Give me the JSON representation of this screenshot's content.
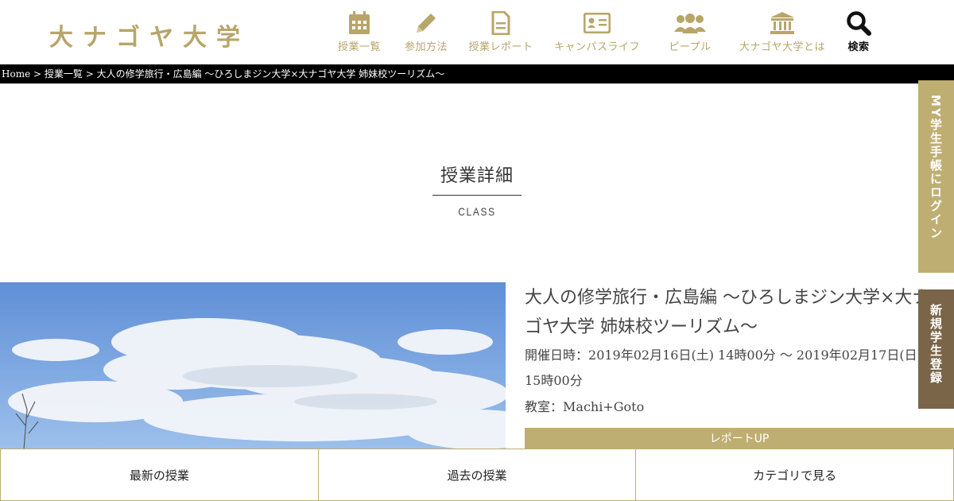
{
  "brand": {
    "logo_text": "大ナゴヤ大学",
    "accent_color": "#bfae72",
    "dark_accent": "#7a6548"
  },
  "nav": {
    "items": [
      {
        "label": "授業一覧",
        "icon": "calendar-icon"
      },
      {
        "label": "参加方法",
        "icon": "pencil-icon"
      },
      {
        "label": "授業レポート",
        "icon": "document-icon"
      },
      {
        "label": "キャンパスライフ",
        "icon": "id-card-icon"
      },
      {
        "label": "ピープル",
        "icon": "people-icon"
      },
      {
        "label": "大ナゴヤ大学とは",
        "icon": "university-icon"
      },
      {
        "label": "検索",
        "icon": "search-icon"
      }
    ]
  },
  "breadcrumb": {
    "home": "Home",
    "sep": " > ",
    "list": "授業一覧",
    "current": "大人の修学旅行・広島編 〜ひろしまジン大学×大ナゴヤ大学 姉妹校ツーリズム〜"
  },
  "section": {
    "title": "授業詳細",
    "subtitle": "CLASS"
  },
  "class": {
    "title": "大人の修学旅行・広島編 〜ひろしまジン大学×大ナゴヤ大学 姉妹校ツーリズム〜",
    "date_label": "開催日時：",
    "date_value": "2019年02月16日(土) 14時00分 ～ 2019年02月17日(日) 15時00分",
    "room_label": "教室：",
    "room_value": "Machi+Goto",
    "badge": "レポートUP"
  },
  "side": {
    "login": "MY学生手帳にログイン",
    "register": "新規学生登録"
  },
  "bottom": {
    "latest": "最新の授業",
    "past": "過去の授業",
    "category": "カテゴリで見る"
  }
}
